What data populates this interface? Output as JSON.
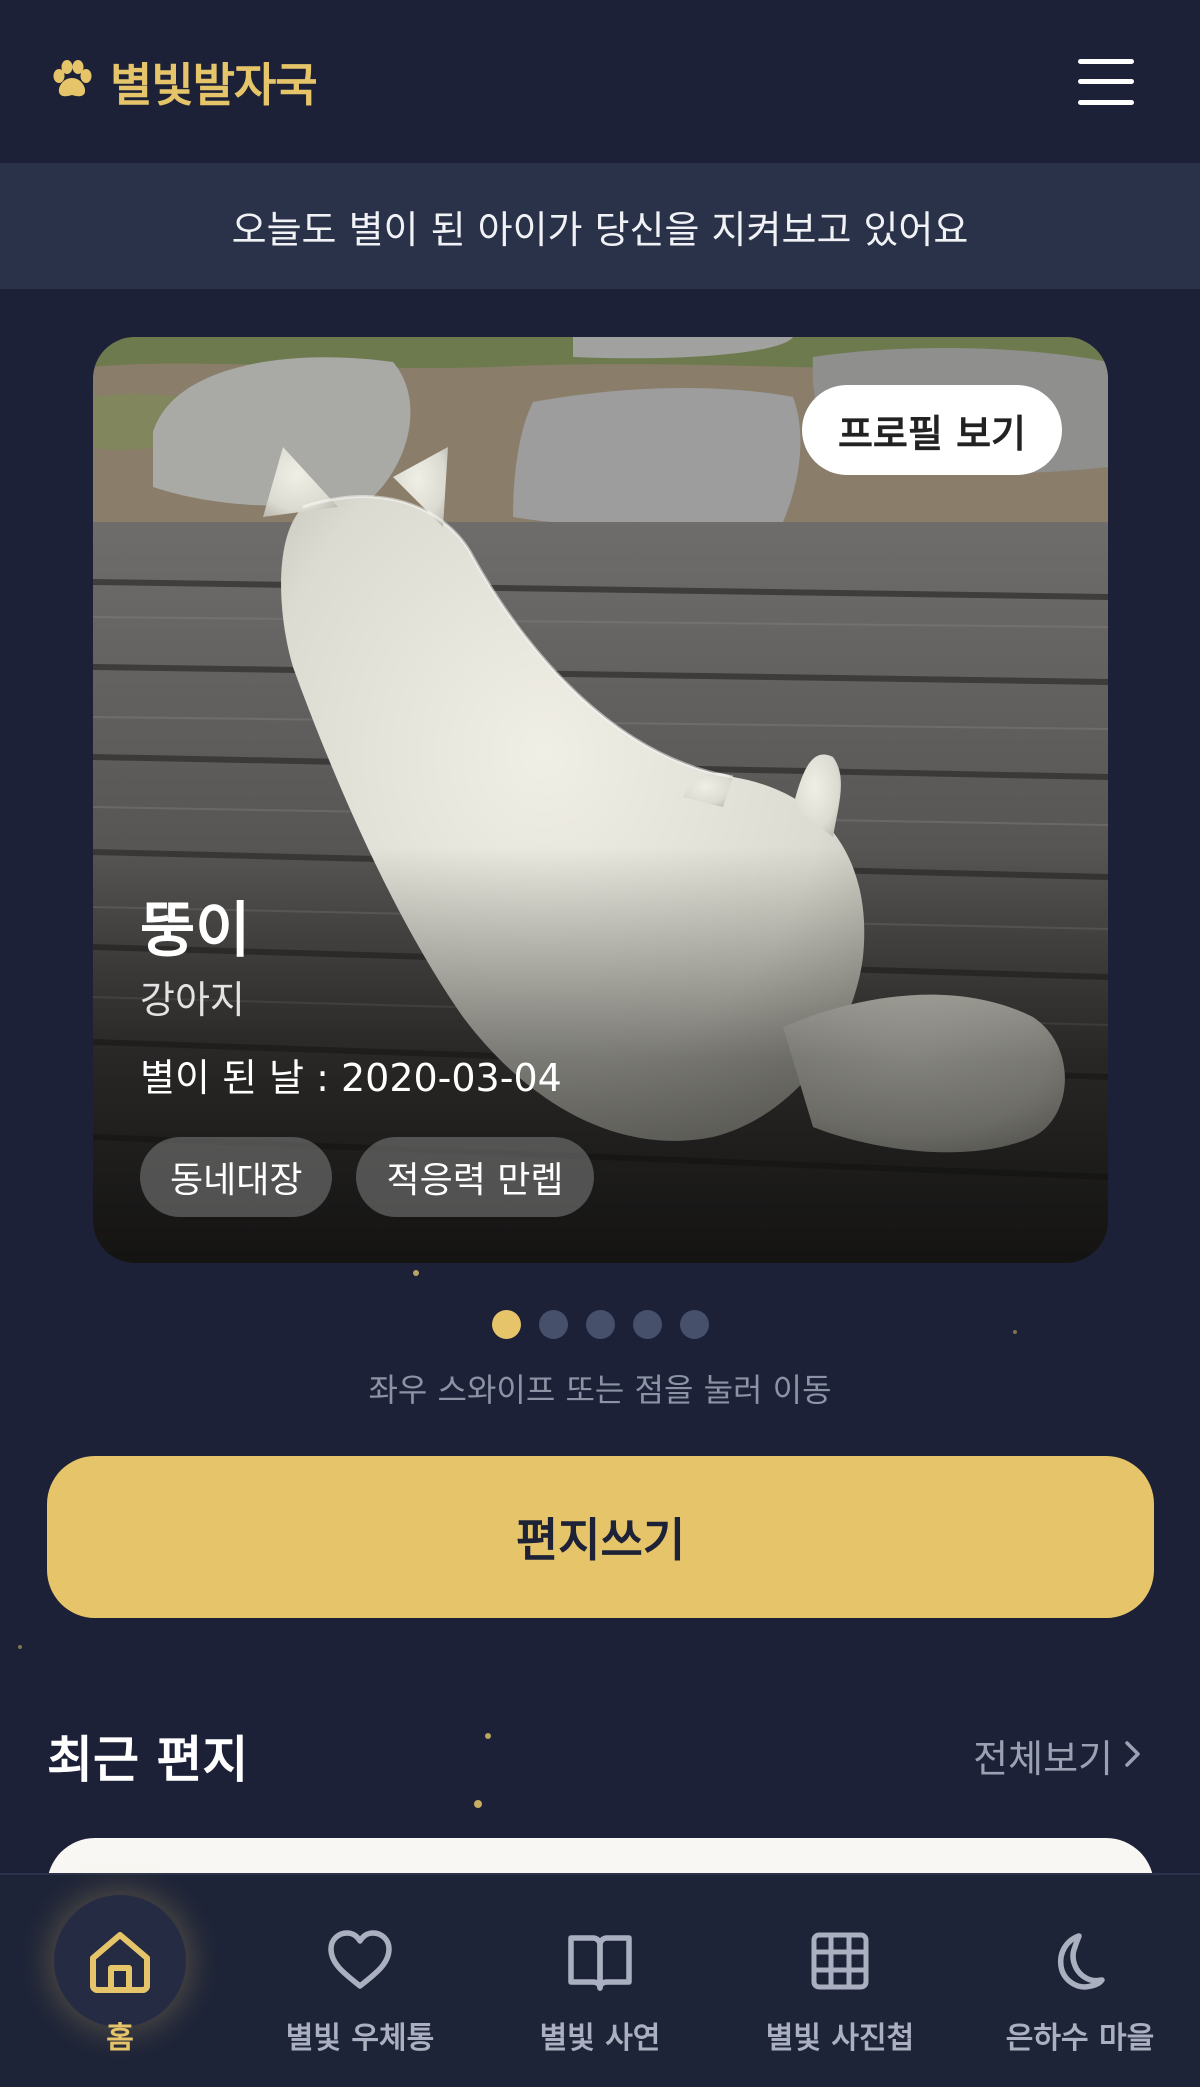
{
  "header": {
    "logo_text": "별빛발자국"
  },
  "banner": {
    "text": "오늘도 별이 된 아이가 당신을 지켜보고 있어요"
  },
  "pet_card": {
    "profile_button": "프로필 보기",
    "name": "뚱이",
    "type": "강아지",
    "date_text": "별이 된 날 : 2020-03-04",
    "tags": [
      "동네대장",
      "적응력 만렙"
    ]
  },
  "carousel": {
    "total": 5,
    "active_index": 0,
    "hint": "좌우 스와이프 또는 점을 눌러 이동"
  },
  "write_button": "편지쓰기",
  "recent": {
    "title": "최근 편지",
    "see_all": "전체보기"
  },
  "nav": {
    "items": [
      {
        "label": "홈",
        "icon": "home-icon",
        "active": true
      },
      {
        "label": "별빛 우체통",
        "icon": "heart-icon",
        "active": false
      },
      {
        "label": "별빛 사연",
        "icon": "book-icon",
        "active": false
      },
      {
        "label": "별빛 사진첩",
        "icon": "grid-icon",
        "active": false
      },
      {
        "label": "은하수 마을",
        "icon": "moon-icon",
        "active": false
      }
    ]
  },
  "colors": {
    "background": "#1c2137",
    "accent": "#e5c46a",
    "banner": "#2a3249",
    "nav": "#1e2438"
  }
}
